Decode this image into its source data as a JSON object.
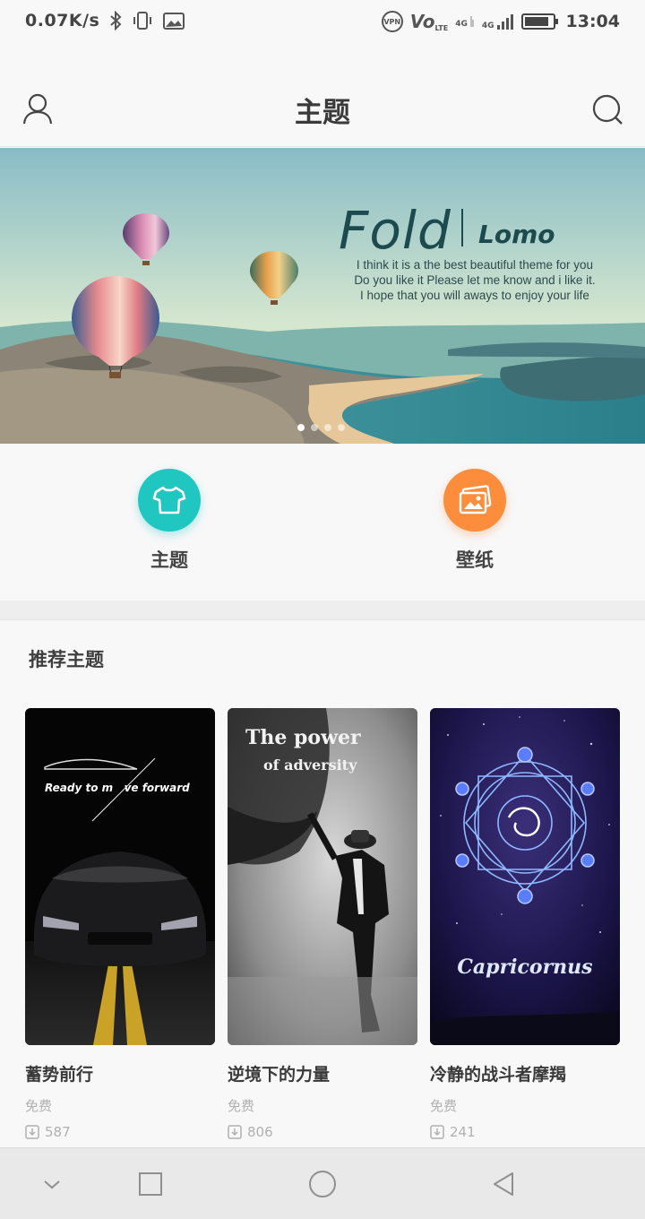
{
  "status_bar": {
    "net_speed": "0.07K/s",
    "vpn": "VPN",
    "volte": "Vo",
    "lte": "LTE",
    "net1": "4G",
    "net2": "4G",
    "time": "13:04",
    "battery_level": 0.85
  },
  "header": {
    "title": "主题"
  },
  "banner": {
    "title": "Fold",
    "subtitle": "Lomo",
    "lines": [
      "I think it is a the best beautiful  theme for you",
      "Do you like it Please let me know and i like it.",
      "I hope that you will aways to enjoy your life"
    ],
    "slide_count": 4,
    "active_slide": 1
  },
  "categories": [
    {
      "label": "主题",
      "icon": "tshirt-icon",
      "color": "#1fc7c0"
    },
    {
      "label": "壁纸",
      "icon": "picture-icon",
      "color": "#fb8d3c"
    }
  ],
  "recommended": {
    "title": "推荐主题",
    "items": [
      {
        "name": "蓄势前行",
        "price": "免费",
        "downloads": "587",
        "thumb_text": "Ready to move forward",
        "thumb_overlay": "Ready to m",
        "thumb_overlay2": "ve forward"
      },
      {
        "name": "逆境下的力量",
        "price": "免费",
        "downloads": "806",
        "thumb_text": "The power",
        "thumb_text2": "of adversity"
      },
      {
        "name": "冷静的战斗者摩羯",
        "price": "免费",
        "downloads": "241",
        "thumb_text": "Capricornus"
      }
    ]
  },
  "colors": {
    "accent_teal": "#1fc7c0",
    "accent_orange": "#fb8d3c",
    "banner_text": "#1d4a4e"
  }
}
